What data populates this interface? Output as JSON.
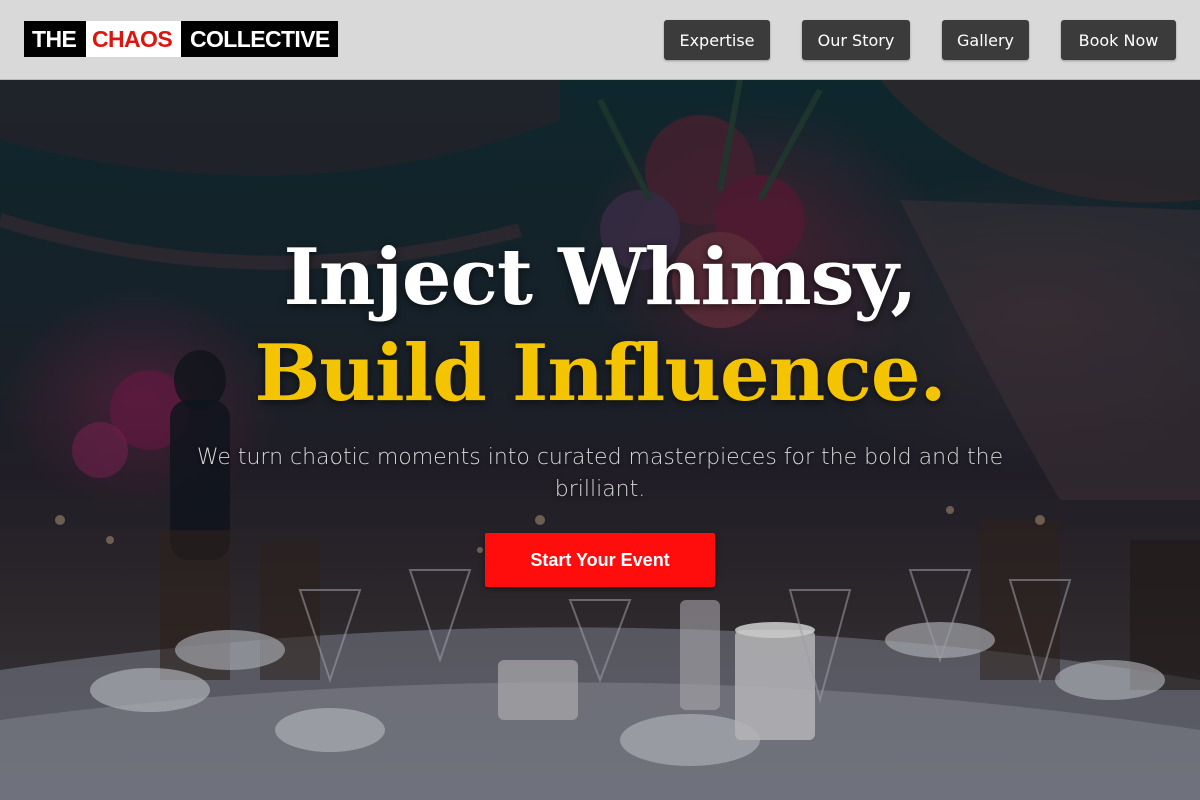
{
  "brand": {
    "word1": "THE",
    "word2": "CHAOS",
    "word3": "COLLECTIVE",
    "accent_color": "#e0140f"
  },
  "nav": {
    "items": [
      {
        "label": "Expertise"
      },
      {
        "label": "Our Story"
      },
      {
        "label": "Gallery"
      },
      {
        "label": "Book Now"
      }
    ]
  },
  "hero": {
    "headline_line1": "Inject Whimsy,",
    "headline_line2": "Build Influence.",
    "headline_accent_color": "#f5c400",
    "subtitle": "We turn chaotic moments into curated masterpieces for the bold and the brilliant.",
    "cta_label": "Start Your Event",
    "cta_color": "#ff0d0d",
    "background_image": "dimly lit banquet table with candles, glassware and floral centerpiece"
  }
}
